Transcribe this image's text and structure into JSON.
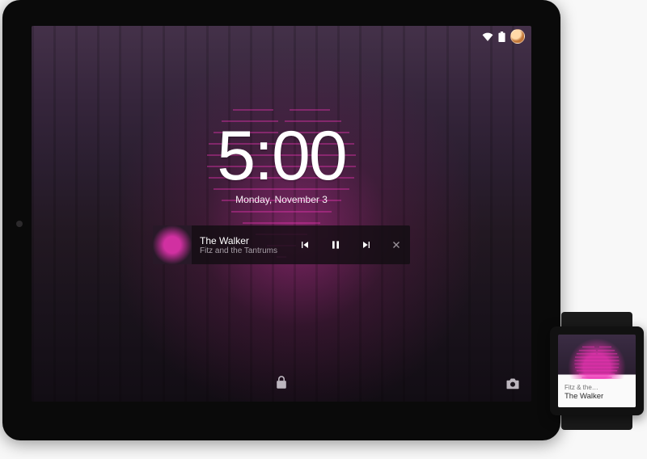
{
  "tablet": {
    "clock": {
      "time": "5:00",
      "date": "Monday, November 3"
    },
    "media": {
      "title": "The Walker",
      "artist": "Fitz and the Tantrums"
    },
    "icons": {
      "wifi": "wifi-icon",
      "battery": "battery-icon",
      "avatar": "user-avatar",
      "lock": "lock-icon",
      "camera": "camera-icon",
      "prev": "skip-previous-icon",
      "pause": "pause-icon",
      "next": "skip-next-icon",
      "close": "close-icon"
    }
  },
  "watch": {
    "artist": "Fitz & the…",
    "title": "The Walker"
  },
  "colors": {
    "accent": "#ee33b5",
    "text": "#ffffff"
  }
}
